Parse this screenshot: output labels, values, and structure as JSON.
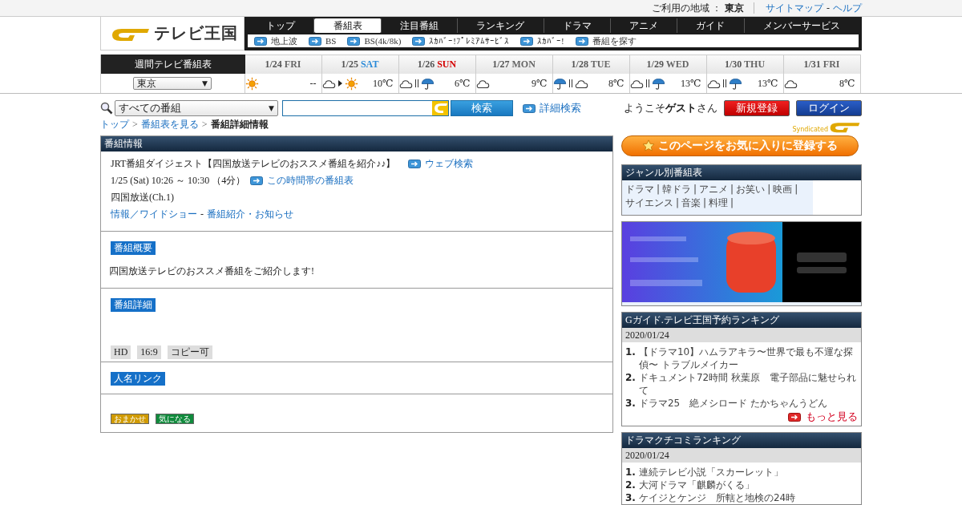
{
  "top_bar": {
    "region_label": "ご利用の地域 ：",
    "region": "東京",
    "links": [
      "サイトマップ",
      "ヘルプ"
    ],
    "separator": "-"
  },
  "logo": {
    "text": "テレビ王国"
  },
  "nav": {
    "tabs": [
      {
        "label": "トップ",
        "selected": false
      },
      {
        "label": "番組表",
        "selected": true
      },
      {
        "label": "注目番組",
        "selected": false
      },
      {
        "label": "ランキング",
        "selected": false
      },
      {
        "label": "ドラマ",
        "selected": false
      },
      {
        "label": "アニメ",
        "selected": false
      },
      {
        "label": "ガイド",
        "selected": false
      },
      {
        "label": "メンバーサービス",
        "selected": false
      }
    ],
    "sub_links": [
      "地上波",
      "BS",
      "BS(4k/8k)",
      "ｽｶﾊﾞｰ!ﾌﾟﾚﾐｱﾑｻｰﾋﾞｽ",
      "ｽｶﾊﾞｰ!",
      "番組を探す"
    ]
  },
  "weekly": {
    "title": "週間テレビ番組表",
    "area": "東京",
    "dropdown_arrow": "▼",
    "days": [
      {
        "date": "1/24",
        "weekday": "FRI",
        "color": "#666666",
        "weather": [
          {
            "kind": "sun"
          }
        ],
        "temp": "--"
      },
      {
        "date": "1/25",
        "weekday": "SAT",
        "color": "#2a8ad8",
        "weather": [
          {
            "kind": "cloud"
          },
          {
            "kind": "then"
          },
          {
            "kind": "sun"
          }
        ],
        "temp": "10℃"
      },
      {
        "date": "1/26",
        "weekday": "SUN",
        "color": "#d40000",
        "weather": [
          {
            "kind": "cloud"
          },
          {
            "kind": "sometimes"
          },
          {
            "kind": "rain"
          }
        ],
        "temp": "6℃"
      },
      {
        "date": "1/27",
        "weekday": "MON",
        "color": "#666666",
        "weather": [
          {
            "kind": "cloud"
          }
        ],
        "temp": "9℃"
      },
      {
        "date": "1/28",
        "weekday": "TUE",
        "color": "#666666",
        "weather": [
          {
            "kind": "rain"
          },
          {
            "kind": "sometimes"
          },
          {
            "kind": "cloud"
          }
        ],
        "temp": "8℃"
      },
      {
        "date": "1/29",
        "weekday": "WED",
        "color": "#666666",
        "weather": [
          {
            "kind": "cloud"
          },
          {
            "kind": "sometimes"
          },
          {
            "kind": "rain"
          }
        ],
        "temp": "13℃"
      },
      {
        "date": "1/30",
        "weekday": "THU",
        "color": "#666666",
        "weather": [
          {
            "kind": "cloud"
          },
          {
            "kind": "sometimes"
          },
          {
            "kind": "rain"
          }
        ],
        "temp": "13℃"
      },
      {
        "date": "1/31",
        "weekday": "FRI",
        "color": "#666666",
        "weather": [
          {
            "kind": "cloud"
          }
        ],
        "temp": "8℃"
      }
    ]
  },
  "search": {
    "category": "すべての番組",
    "dropdown_arrow": "▼",
    "button": "検索",
    "advanced": "詳細検索"
  },
  "user": {
    "greeting": "ようこそ**ゲスト**さん",
    "register": "新規登録",
    "login": "ログイン",
    "syndicated": "Syndicated"
  },
  "breadcrumb": {
    "separator": ">",
    "items": [
      {
        "label": "トップ",
        "link": true
      },
      {
        "label": "番組表を見る",
        "link": true
      },
      {
        "label": "番組詳細情報",
        "link": false
      }
    ]
  },
  "program": {
    "header": "番組情報",
    "title": "JRT番組ダイジェスト【四国放送テレビのおススメ番組を紹介♪♪】",
    "web_search": "ウェブ検索",
    "time": "1/25 (Sat) 10:26 ～ 10:30 （4分）",
    "time_table_link": "この時間帯の番組表",
    "channel": "四国放送(Ch.1)",
    "genres": [
      "情報／ワイドショー",
      "番組紹介・お知らせ"
    ],
    "genre_separator": "-",
    "sections": [
      {
        "kind": "text",
        "heading": "番組概要",
        "text": "四国放送テレビのおススメ番組をご紹介します!"
      },
      {
        "kind": "tags",
        "heading": "番組詳細",
        "tags": [
          "HD",
          "16:9",
          "コピー可"
        ]
      },
      {
        "kind": "empty",
        "heading": "人名リンク"
      }
    ],
    "actions": [
      {
        "label": "おまかせ",
        "color": "#d09a00"
      },
      {
        "label": "気になる",
        "color": "#108a3c"
      }
    ]
  },
  "sidebar": {
    "favorite_button": "このページをお気に入りに登録する",
    "genre_box": {
      "title": "ジャンル別番組表",
      "separator": "|",
      "items": [
        "ドラマ",
        "韓ドラ",
        "アニメ",
        "お笑い",
        "映画",
        "サイエンス",
        "音楽",
        "料理"
      ]
    },
    "rankings": [
      {
        "title": "Gガイド.テレビ王国予約ランキング",
        "date": "2020/01/24",
        "more": "もっと見る",
        "items": [
          {
            "rank": "1.",
            "title": "【ドラマ10】ハムラアキラ〜世界で最も不運な探偵〜 トラブルメイカー"
          },
          {
            "rank": "2.",
            "title": "ドキュメント72時間 秋葉原　電子部品に魅せられて"
          },
          {
            "rank": "3.",
            "title": "ドラマ25　絶メシロード たかちゃんうどん"
          }
        ]
      },
      {
        "title": "ドラマクチコミランキング",
        "date": "2020/01/24",
        "items": [
          {
            "rank": "1.",
            "title": "連続テレビ小説「スカーレット」"
          },
          {
            "rank": "2.",
            "title": "大河ドラマ「麒麟がくる」"
          },
          {
            "rank": "3.",
            "title": "ケイジとケンジ　所轄と地検の24時"
          }
        ]
      }
    ]
  }
}
